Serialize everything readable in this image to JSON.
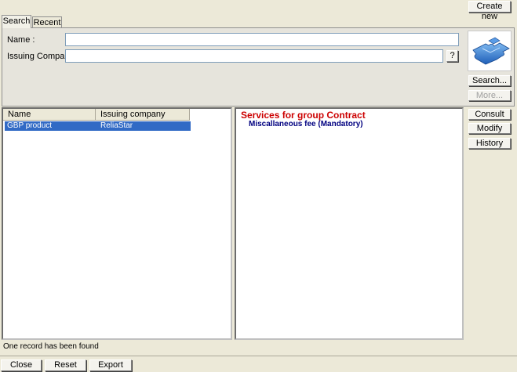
{
  "header": {
    "create_new_label": "Create new"
  },
  "tabs": [
    {
      "label": "Search",
      "active": true
    },
    {
      "label": "Recent",
      "active": false
    }
  ],
  "search_form": {
    "name_label": "Name :",
    "name_value": "",
    "issuing_company_label": "Issuing Company :",
    "issuing_company_value": "",
    "help_label": "?"
  },
  "side_buttons": {
    "search_label": "Search...",
    "more_label": "More...",
    "consult_label": "Consult",
    "modify_label": "Modify",
    "history_label": "History"
  },
  "results": {
    "columns": [
      "Name",
      "Issuing company"
    ],
    "rows": [
      {
        "name": "GBP product",
        "issuing_company": "ReliaStar",
        "selected": true
      }
    ]
  },
  "detail": {
    "title": "Services for group Contract",
    "items": [
      "Miscallaneous fee (Mandatory)"
    ],
    "title_color": "#cc0000",
    "item_color": "#000080"
  },
  "status": {
    "text": "One record has been found"
  },
  "footer": {
    "close_label": "Close",
    "reset_label": "Reset",
    "export_label": "Export"
  },
  "icons": {
    "logo": "puzzle-pieces-icon"
  }
}
